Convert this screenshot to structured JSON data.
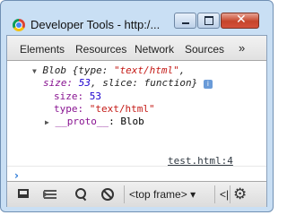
{
  "window": {
    "title": "Developer Tools - http:/...",
    "min_icon": "minimize-icon",
    "max_icon": "maximize-icon",
    "close_glyph": "✕"
  },
  "tabs": [
    {
      "label": "Elements"
    },
    {
      "label": "Resources"
    },
    {
      "label": "Network"
    },
    {
      "label": "Sources"
    }
  ],
  "tabs_overflow": "»",
  "console": {
    "object_label": "Blob",
    "summary_open": " {type: ",
    "type_value": "\"text/html\"",
    "summary_size_key": "size: ",
    "size_value": "53",
    "summary_slice_key": ", slice: ",
    "slice_value": "function",
    "summary_close": "}",
    "info_glyph": "i",
    "prop_size_key": "size: ",
    "prop_size_value": "53",
    "prop_type_key": "type: ",
    "prop_type_value": "\"text/html\"",
    "proto_key": "__proto__",
    "proto_sep": ": ",
    "proto_value": "Blob",
    "source_link": "test.html:4",
    "prompt_glyph": "›"
  },
  "toolbar": {
    "frame_selector": "<top frame>",
    "frame_arrow": "▾",
    "truncated_item": "<|",
    "settings_glyph": "⚙"
  }
}
